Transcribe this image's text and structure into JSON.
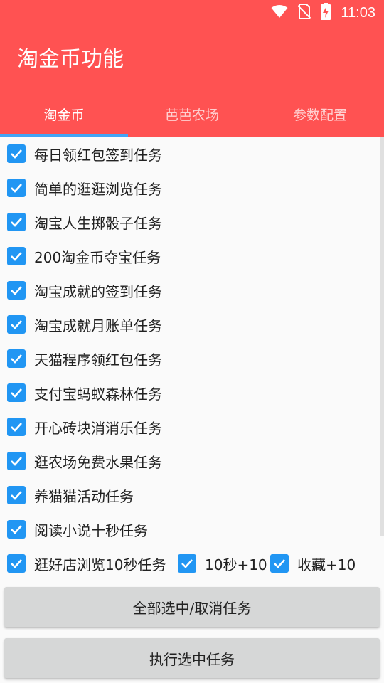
{
  "status_bar": {
    "time": "11:03",
    "icons": [
      "wifi-icon",
      "no-sim-icon",
      "battery-charging-icon"
    ]
  },
  "colors": {
    "primary": "#ff5252",
    "accent": "#2196f3",
    "indicator": "#42a5f5"
  },
  "app_title": "淘金币功能",
  "tabs": [
    {
      "label": "淘金币",
      "selected": true
    },
    {
      "label": "芭芭农场",
      "selected": false
    },
    {
      "label": "参数配置",
      "selected": false
    }
  ],
  "tasks": [
    {
      "label": "每日领红包签到任务",
      "checked": true
    },
    {
      "label": "简单的逛逛浏览任务",
      "checked": true
    },
    {
      "label": "淘宝人生掷骰子任务",
      "checked": true
    },
    {
      "label": "200淘金币夺宝任务",
      "checked": true
    },
    {
      "label": "淘宝成就的签到任务",
      "checked": true
    },
    {
      "label": "淘宝成就月账单任务",
      "checked": true
    },
    {
      "label": "天猫程序领红包任务",
      "checked": true
    },
    {
      "label": "支付宝蚂蚁森林任务",
      "checked": true
    },
    {
      "label": "开心砖块消消乐任务",
      "checked": true
    },
    {
      "label": "逛农场免费水果任务",
      "checked": true
    },
    {
      "label": "养猫猫活动任务",
      "checked": true
    },
    {
      "label": "阅读小说十秒任务",
      "checked": true
    }
  ],
  "last_row": [
    {
      "label": "逛好店浏览10秒任务",
      "checked": true
    },
    {
      "label": "10秒+10",
      "checked": true
    },
    {
      "label": "收藏+10",
      "checked": true
    }
  ],
  "buttons": {
    "select_all": "全部选中/取消任务",
    "execute": "执行选中任务"
  }
}
